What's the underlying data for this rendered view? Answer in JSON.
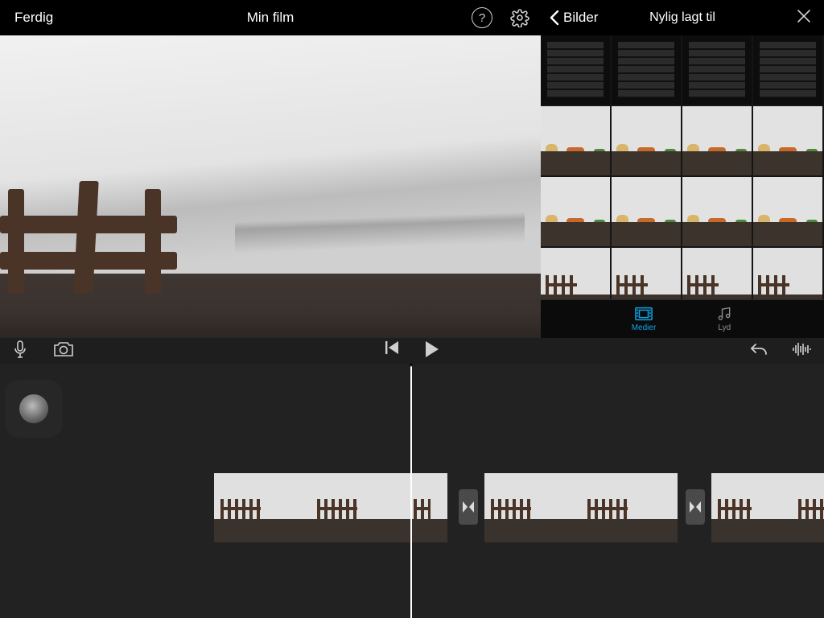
{
  "header": {
    "done_label": "Ferdig",
    "title": "Min film",
    "bilder_label": "Bilder",
    "recently_added": "Nylig lagt til"
  },
  "media_tabs": {
    "media_label": "Medier",
    "audio_label": "Lyd"
  }
}
